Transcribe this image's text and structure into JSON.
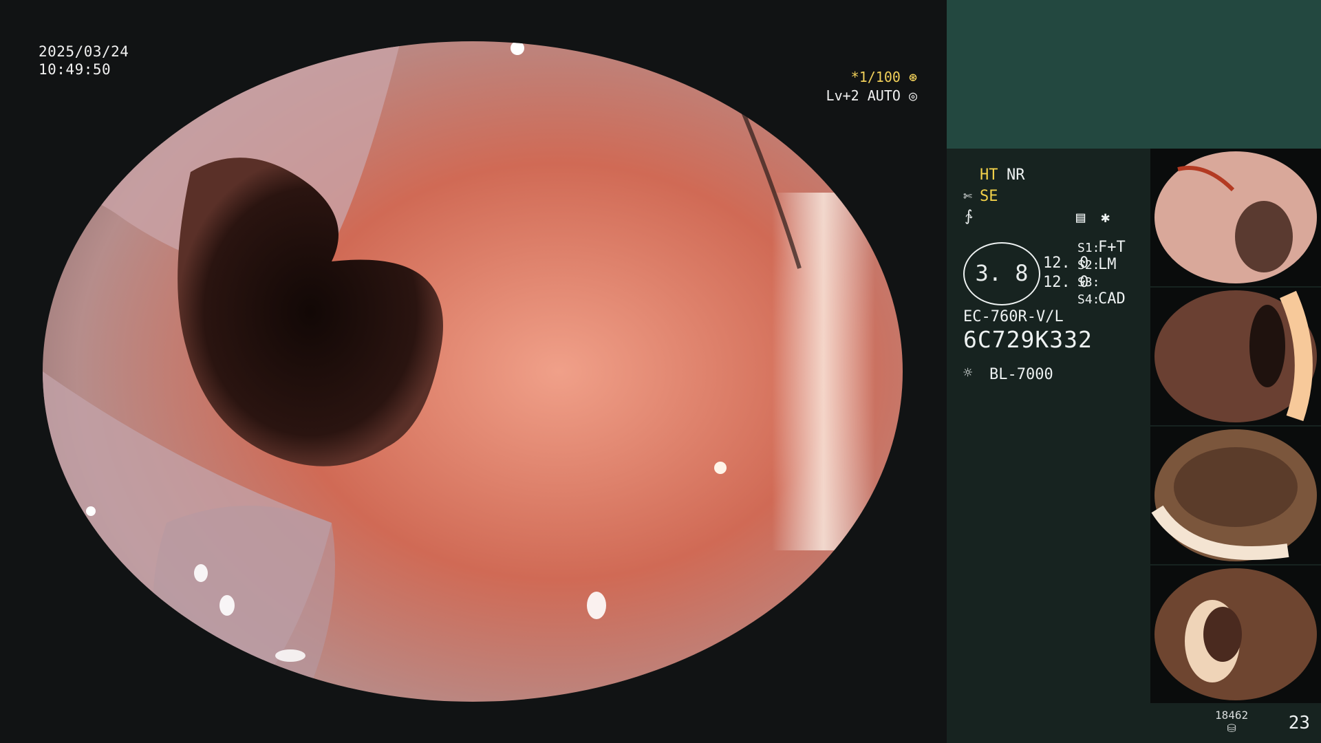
{
  "timestamp": {
    "date": "2025/03/24",
    "time": "10:49:50"
  },
  "overlay": {
    "zoom": "*1/100",
    "level": "Lv+2 AUTO"
  },
  "settings": {
    "mode1": "HT",
    "mode2": "NR",
    "mode3": "SE",
    "brightness": "3. 8",
    "value_a": "12. 0",
    "value_b": "12. 0",
    "s1_label": "S1:",
    "s1_value": "F+T",
    "s2_label": "S2:",
    "s2_value": "LM",
    "s3_label": "S3:",
    "s4_label": "S4:",
    "s4_value": "CAD",
    "scope_model": "EC-760R-V/L",
    "serial": "6C729K332",
    "light_source": "BL-7000"
  },
  "footer": {
    "stack_count": "18462",
    "image_count": "23"
  },
  "icons": [
    "aperture-icon",
    "iris-icon",
    "scissors-icon",
    "wave-icon",
    "memo-icon",
    "asterisk-icon",
    "sun-icon",
    "stack-icon"
  ],
  "colors": {
    "accent_yellow": "#f3d24a",
    "panel_bg": "#172320",
    "panel_top": "#234840"
  }
}
